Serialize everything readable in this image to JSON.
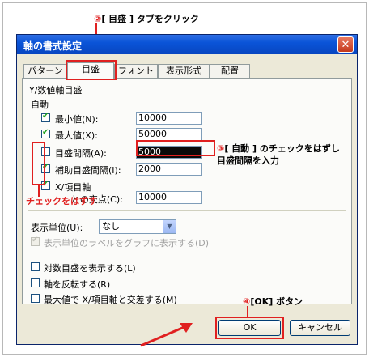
{
  "annotations": {
    "step2_num": "②",
    "step2_text": "[ 目盛 ] タブをクリック",
    "step3_num": "③",
    "step3_line1": "[ 自動 ] のチェックをはずし",
    "step3_line2": "目盛間隔を入力",
    "uncheck_note": "チェックをはずす",
    "step4_num": "④",
    "step4_text": "[OK] ボタン"
  },
  "dialog": {
    "title": "軸の書式設定",
    "close_symbol": "✕",
    "tabs": [
      {
        "label": "パターン"
      },
      {
        "label": "目盛"
      },
      {
        "label": "フォント"
      },
      {
        "label": "表示形式"
      },
      {
        "label": "配置"
      }
    ],
    "section_title": "Y/数値軸目盛",
    "auto_label": "自動",
    "rows": [
      {
        "label": "最小値(N):",
        "value": "10000",
        "checked": true
      },
      {
        "label": "最大値(X):",
        "value": "50000",
        "checked": true
      },
      {
        "label": "目盛間隔(A):",
        "value": "5000",
        "checked": false
      },
      {
        "label": "補助目盛間隔(I):",
        "value": "2000",
        "checked": true
      },
      {
        "label": "X/項目軸",
        "checked": true
      }
    ],
    "cross_label": "との交点(C):",
    "cross_value": "10000",
    "display_unit_label": "表示単位(U):",
    "display_unit_value": "なし",
    "display_label_checkbox": "表示単位のラベルをグラフに表示する(D)",
    "bottom_checks": [
      {
        "label": "対数目盛を表示する(L)"
      },
      {
        "label": "軸を反転する(R)"
      },
      {
        "label": "最大値で X/項目軸と交差する(M)"
      }
    ],
    "ok_label": "OK",
    "cancel_label": "キャンセル"
  },
  "colors": {
    "accent": "#e02020",
    "title_bar": "#0a54d8",
    "dialog_bg": "#ece9d8"
  }
}
